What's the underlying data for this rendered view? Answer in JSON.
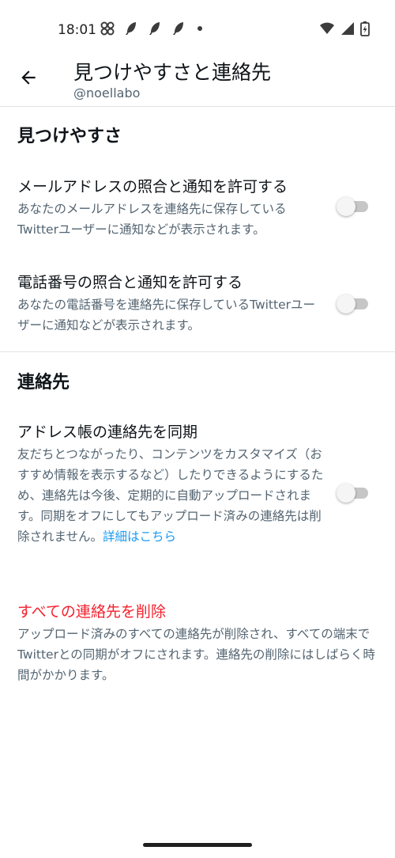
{
  "status_bar": {
    "time": "18:01",
    "icons_left": [
      "pinwheel-icon",
      "feather-icon",
      "feather-icon",
      "feather-icon",
      "dot-icon"
    ],
    "icons_right": [
      "wifi-icon",
      "signal-icon",
      "battery-charging-icon"
    ]
  },
  "header": {
    "title": "見つけやすさと連絡先",
    "subtitle": "@noellabo"
  },
  "discoverability": {
    "section_title": "見つけやすさ",
    "email": {
      "label": "メールアドレスの照合と通知を許可する",
      "description": "あなたのメールアドレスを連絡先に保存しているTwitterユーザーに通知などが表示されます。",
      "enabled": false
    },
    "phone": {
      "label": "電話番号の照合と通知を許可する",
      "description": "あなたの電話番号を連絡先に保存しているTwitterユーザーに通知などが表示されます。",
      "enabled": false
    }
  },
  "contacts": {
    "section_title": "連絡先",
    "sync": {
      "label": "アドレス帳の連絡先を同期",
      "description": "友だちとつながったり、コンテンツをカスタマイズ（おすすめ情報を表示するなど）したりできるようにするため、連絡先は今後、定期的に自動アップロードされます。同期をオフにしてもアップロード済みの連絡先は削除されません。",
      "link": "詳細はこちら",
      "enabled": false
    },
    "delete": {
      "label": "すべての連絡先を削除",
      "description": "アップロード済みのすべての連絡先が削除され、すべての端末でTwitterとの同期がオフにされます。連絡先の削除にはしばらく時間がかかります。"
    }
  },
  "colors": {
    "text_primary": "#0f1419",
    "text_secondary": "#536471",
    "link": "#1d9bf0",
    "danger": "#f4212e",
    "toggle_off_track": "#c6c6c6"
  }
}
